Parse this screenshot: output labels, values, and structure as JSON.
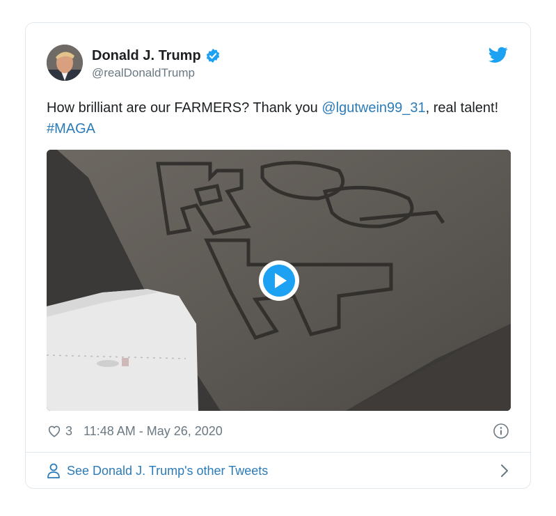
{
  "author": {
    "name": "Donald J. Trump",
    "handle": "@realDonaldTrump"
  },
  "tweet": {
    "text_before": "How brilliant are our FARMERS? Thank you ",
    "mention": "@lgutwein99_31",
    "text_middle": ", real talent! ",
    "hashtag": "#MAGA"
  },
  "stats": {
    "likes": "3",
    "timestamp": "11:48 AM - May 26, 2020"
  },
  "footer": {
    "label": "See Donald J. Trump's other Tweets"
  },
  "icons": {
    "verified": "verified-badge-icon",
    "bird": "twitter-bird-icon",
    "play": "play-icon",
    "heart": "heart-icon",
    "info": "info-icon",
    "person": "person-icon",
    "chevron": "chevron-right-icon"
  },
  "colors": {
    "brand": "#1da1f2",
    "link": "#2b7bb9",
    "text": "#1c2022",
    "muted": "#697882",
    "border": "#e1e8ed"
  }
}
